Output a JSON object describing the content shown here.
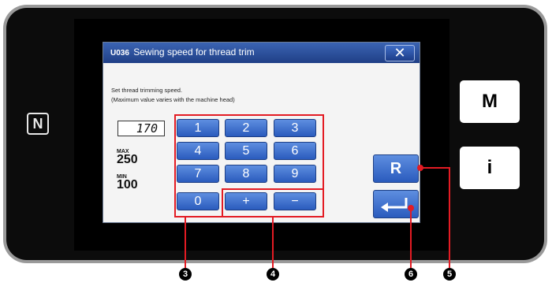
{
  "dialog": {
    "code": "U036",
    "title": "Sewing speed for thread trim",
    "close_glyph": "✕",
    "desc_line1": "Set thread trimming speed.",
    "desc_line2": "(Maximum value varies with the machine head)",
    "value": "170",
    "max_label": "MAX",
    "max_value": "250",
    "min_label": "MIN",
    "min_value": "100"
  },
  "keypad": {
    "k1": "1",
    "k2": "2",
    "k3": "3",
    "k4": "4",
    "k5": "5",
    "k6": "6",
    "k7": "7",
    "k8": "8",
    "k9": "9",
    "k0": "0",
    "plus": "+",
    "minus": "−"
  },
  "buttons": {
    "reset": "R",
    "enter_icon": "enter-arrow-icon"
  },
  "side": {
    "menu": "M",
    "info": "i",
    "nfc_icon": "nfc-icon",
    "nfc_glyph": "N"
  },
  "callouts": {
    "c3": "3",
    "c4": "4",
    "c6": "6",
    "c5": "5"
  },
  "colors": {
    "title_bar": "#1f3f86",
    "key_blue": "#2a5bbd",
    "callout_red": "#e31b23"
  }
}
